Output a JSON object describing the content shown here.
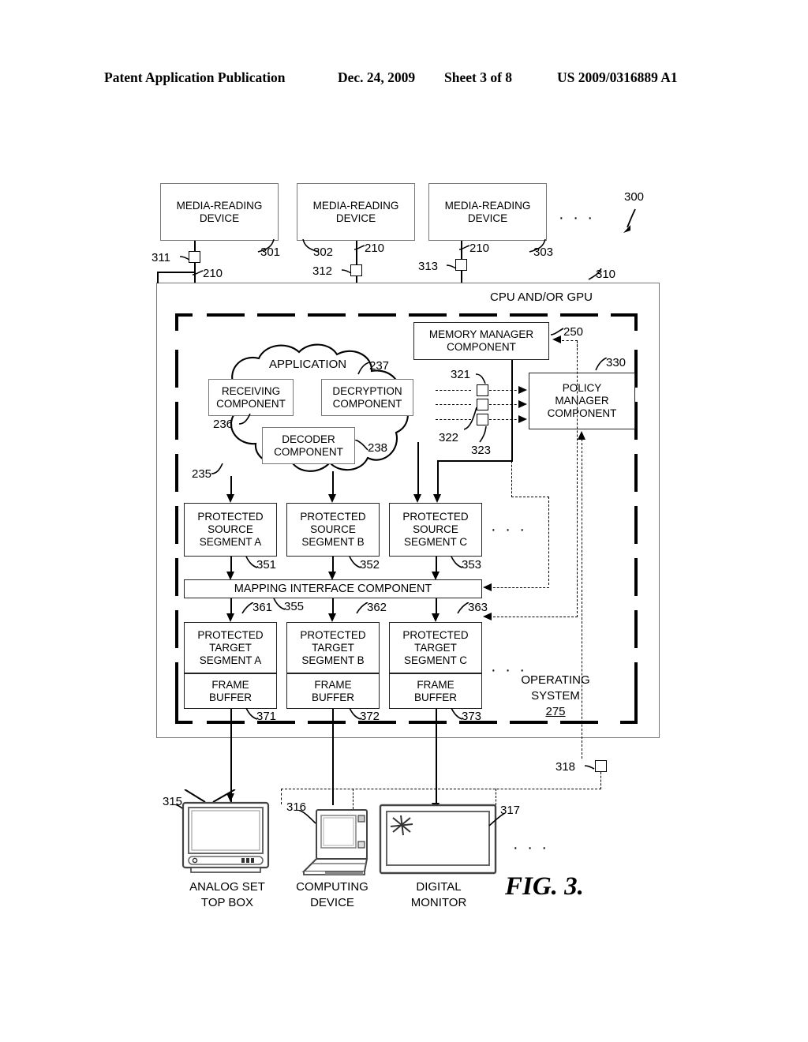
{
  "header": {
    "publication": "Patent Application Publication",
    "date": "Dec. 24, 2009",
    "sheet": "Sheet 3 of 8",
    "number": "US 2009/0316889 A1"
  },
  "figure": {
    "caption": "FIG. 3.",
    "system_ref": "300"
  },
  "media_devices": [
    {
      "label": "MEDIA-READING DEVICE",
      "ref": "301",
      "port_ref": "311",
      "link_ref": "210"
    },
    {
      "label": "MEDIA-READING DEVICE",
      "ref": "302",
      "port_ref": "312",
      "link_ref": "210"
    },
    {
      "label": "MEDIA-READING DEVICE",
      "ref": "303",
      "port_ref": "313",
      "link_ref": "210"
    }
  ],
  "media_ellipsis": "· · ·",
  "cpu": {
    "title": "CPU AND/OR GPU",
    "ref": "310"
  },
  "operating_system": {
    "label_line1": "OPERATING",
    "label_line2": "SYSTEM",
    "ref": "275"
  },
  "application": {
    "title": "APPLICATION",
    "ref": "235",
    "components": [
      {
        "line1": "RECEIVING",
        "line2": "COMPONENT",
        "ref": "236"
      },
      {
        "line1": "DECRYPTION",
        "line2": "COMPONENT",
        "ref": "237"
      },
      {
        "line1": "DECODER",
        "line2": "COMPONENT",
        "ref": "238"
      }
    ]
  },
  "memory_manager": {
    "line1": "MEMORY MANAGER",
    "line2": "COMPONENT",
    "ref": "250"
  },
  "policy_manager": {
    "line1": "POLICY",
    "line2": "MANAGER",
    "line3": "COMPONENT",
    "ref": "330"
  },
  "channel_ports": [
    {
      "ref": "321"
    },
    {
      "ref": "322"
    },
    {
      "ref": "323"
    }
  ],
  "source_segments": [
    {
      "line1": "PROTECTED",
      "line2": "SOURCE",
      "line3": "SEGMENT A",
      "ref": "351"
    },
    {
      "line1": "PROTECTED",
      "line2": "SOURCE",
      "line3": "SEGMENT B",
      "ref": "352"
    },
    {
      "line1": "PROTECTED",
      "line2": "SOURCE",
      "line3": "SEGMENT C",
      "ref": "353"
    }
  ],
  "source_ellipsis": "· · ·",
  "mapping_interface": {
    "label": "MAPPING INTERFACE COMPONENT",
    "ref": "355"
  },
  "target_segments": [
    {
      "line1": "PROTECTED",
      "line2": "TARGET",
      "line3": "SEGMENT A",
      "ref": "361",
      "buffer_line1": "FRAME",
      "buffer_line2": "BUFFER",
      "buffer_ref": "371"
    },
    {
      "line1": "PROTECTED",
      "line2": "TARGET",
      "line3": "SEGMENT B",
      "ref": "362",
      "buffer_line1": "FRAME",
      "buffer_line2": "BUFFER",
      "buffer_ref": "372"
    },
    {
      "line1": "PROTECTED",
      "line2": "TARGET",
      "line3": "SEGMENT C",
      "ref": "363",
      "buffer_line1": "FRAME",
      "buffer_line2": "BUFFER",
      "buffer_ref": "373"
    }
  ],
  "target_ellipsis": "· · ·",
  "output_devices": [
    {
      "line1": "ANALOG SET",
      "line2": "TOP BOX",
      "ref": "315",
      "icon": "crt-television-icon"
    },
    {
      "line1": "COMPUTING",
      "line2": "DEVICE",
      "ref": "316",
      "icon": "laptop-computer-icon"
    },
    {
      "line1": "DIGITAL",
      "line2": "MONITOR",
      "ref": "317",
      "icon": "flat-panel-monitor-icon"
    }
  ],
  "output_ellipsis": "· · ·",
  "external_port": {
    "ref": "318"
  }
}
